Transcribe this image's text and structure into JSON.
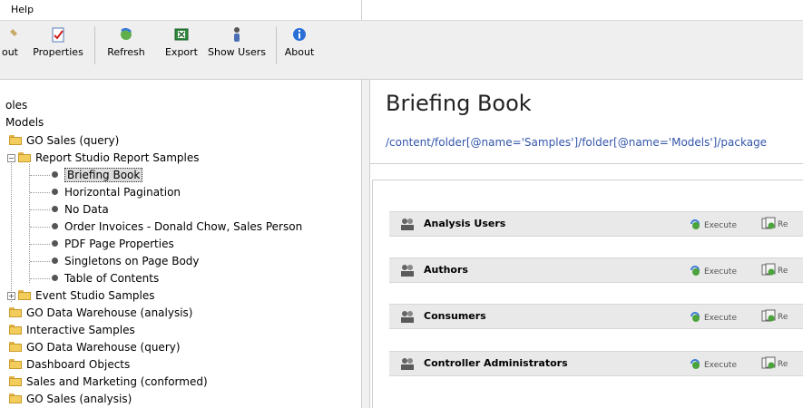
{
  "menubar": {
    "help": "Help"
  },
  "toolbar": {
    "partial_label": "out",
    "properties": "Properties",
    "refresh": "Refresh",
    "export": "Export",
    "show_users": "Show Users",
    "about": "About"
  },
  "tree": {
    "r0": "oles",
    "r1": "Models",
    "r2": "GO Sales (query)",
    "r3": "Report Studio Report Samples",
    "leaves": [
      "Briefing Book",
      "Horizontal Pagination",
      "No Data",
      "Order Invoices - Donald Chow, Sales Person",
      "PDF Page Properties",
      "Singletons on Page Body",
      "Table of Contents"
    ],
    "r11": "Event Studio Samples",
    "r12": "GO Data Warehouse (analysis)",
    "r13": "Interactive Samples",
    "r14": "GO Data Warehouse (query)",
    "r15": "Dashboard Objects",
    "r16": "Sales and Marketing (conformed)",
    "r17": "GO Sales (analysis)"
  },
  "detail": {
    "title": "Briefing Book",
    "path": "/content/folder[@name='Samples']/folder[@name='Models']/package",
    "execute_label": "Execute",
    "report_label": "Re",
    "items": [
      "Analysis Users",
      "Authors",
      "Consumers",
      "Controller Administrators"
    ]
  },
  "colors": {
    "path_link": "#3355aa",
    "row_bg": "#e9e9e9",
    "toolbar_bg": "#efefef"
  }
}
